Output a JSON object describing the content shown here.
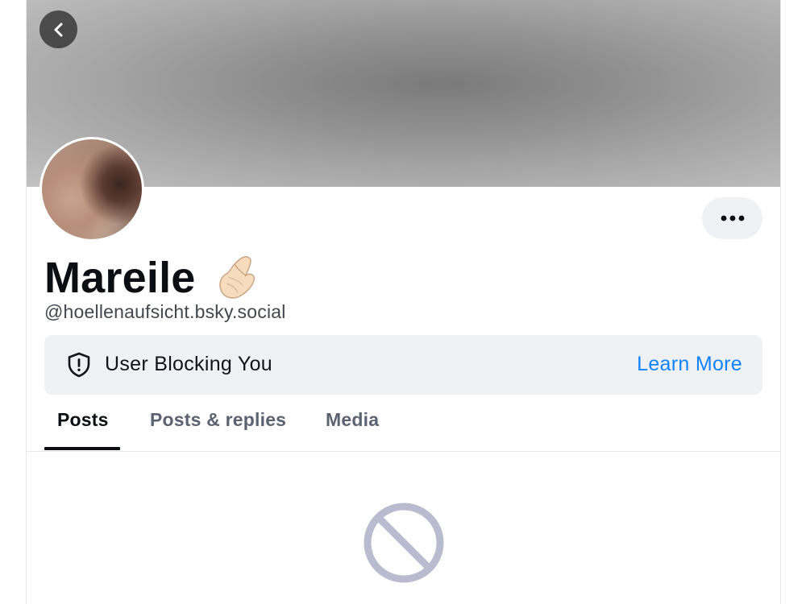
{
  "profile": {
    "display_name": "Mareile",
    "name_emoji": "pinched-fingers-emoji",
    "handle": "@hoellenaufsicht.bsky.social"
  },
  "header": {
    "back_icon": "chevron-left-icon",
    "more_icon": "ellipsis-icon"
  },
  "blocked_notice": {
    "icon": "shield-exclamation-icon",
    "label": "User Blocking You",
    "action_label": "Learn More"
  },
  "tabs": [
    {
      "label": "Posts",
      "active": true
    },
    {
      "label": "Posts & replies",
      "active": false
    },
    {
      "label": "Media",
      "active": false
    }
  ],
  "empty_state": {
    "icon": "no-entry-icon"
  },
  "colors": {
    "accent": "#1083fe",
    "banner_bg": "#f0f1f5",
    "text_primary": "#0b0f14",
    "text_secondary": "#42464d",
    "tab_inactive": "#5b6271",
    "empty_icon": "#b9bcce"
  }
}
